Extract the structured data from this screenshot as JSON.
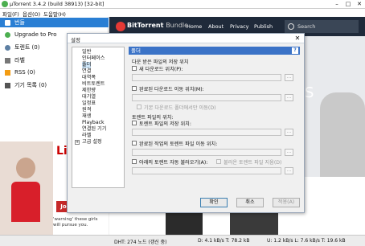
{
  "app": {
    "title": "µTorrent 3.4.2  (build 38913) [32-bit]",
    "window_controls": [
      "–",
      "□",
      "✕"
    ]
  },
  "menu": [
    "파일(F)",
    "옵션(O)",
    "도움말(H)"
  ],
  "sidebar": {
    "items": [
      {
        "label": "번들",
        "icon": "bundle-icon"
      },
      {
        "label": "Upgrade to Pro",
        "icon": "upgrade-icon"
      },
      {
        "label": "토렌트 (0)",
        "icon": "torrent-icon"
      },
      {
        "label": "라벨",
        "icon": "label-icon"
      },
      {
        "label": "RSS (0)",
        "icon": "rss-icon"
      },
      {
        "label": "기기 목록 (0)",
        "icon": "device-icon"
      }
    ]
  },
  "web": {
    "brand_bold": "BitTorrent",
    "brand_light": "Bundle",
    "nav": [
      "Home",
      "About",
      "Privacy",
      "Publish"
    ],
    "search_placeholder": "Search",
    "hero_text": "TS"
  },
  "ads": {
    "left_top": "Li",
    "left_bottom": "Join Now!",
    "warning": "'warning' these girls will pursue you."
  },
  "dialog": {
    "title": "설정",
    "close": "✕",
    "tree": [
      {
        "label": "일반",
        "level": 0
      },
      {
        "label": "인터페이스",
        "level": 0
      },
      {
        "label": "폴더",
        "level": 0,
        "selected": true
      },
      {
        "label": "연결",
        "level": 0
      },
      {
        "label": "대역폭",
        "level": 0
      },
      {
        "label": "비트토렌트",
        "level": 0
      },
      {
        "label": "제한량",
        "level": 0
      },
      {
        "label": "대기열",
        "level": 0
      },
      {
        "label": "일정표",
        "level": 0
      },
      {
        "label": "원격",
        "level": 0
      },
      {
        "label": "재생",
        "level": 0
      },
      {
        "label": "Playback",
        "level": 0
      },
      {
        "label": "연결된 기기",
        "level": 0
      },
      {
        "label": "라벨",
        "level": 0
      },
      {
        "label": "고급 설정",
        "level": 0,
        "expandable": true
      }
    ],
    "panel_title": "폴더",
    "help": "?",
    "sections": {
      "downloaded_location": "다운 받은 파일의 저장 위치",
      "new_downloads": "새 다운로드 위치(P):",
      "move_completed": "완료된 다운로드 이동 위치(M):",
      "only_from_default": "기본 다운로드 폴더에서만 이동(D)",
      "torrent_location": "토렌트 파일의 위치:",
      "store_torrents": "토렌트 파일의 저장 위치:",
      "move_finished_torrents": "완료된 작업의 토렌트 파일 이동 위치:",
      "autoload": "아래의 토렌트 자동 불러오기(A):",
      "delete_loaded": "불러온 토렌트 파일 지움(D)"
    },
    "browse": "...",
    "buttons": {
      "ok": "확인",
      "cancel": "취소",
      "apply": "적용(A)"
    }
  },
  "status": {
    "dht": "DHT: 274 노드  (갱신 중)",
    "download": "D: 4.1 kB/s T: 78.2 kB",
    "upload": "U: 1.2 kB/s L: 7.6 kB/s T: 19.6 kB"
  }
}
